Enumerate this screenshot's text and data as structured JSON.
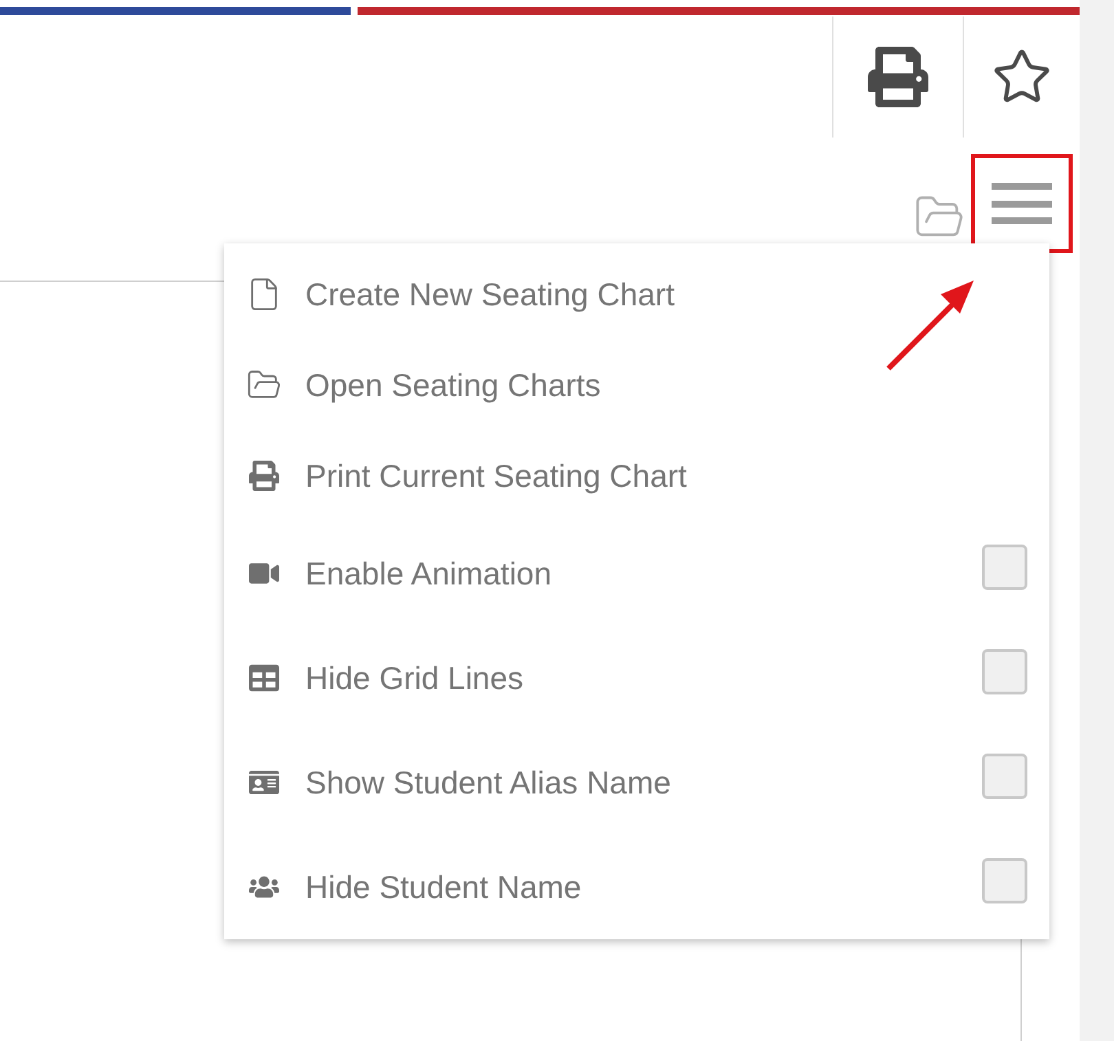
{
  "menu": {
    "items": [
      {
        "label": "Create New Seating Chart",
        "kind": "action"
      },
      {
        "label": "Open Seating Charts",
        "kind": "action"
      },
      {
        "label": "Print Current Seating Chart",
        "kind": "action"
      },
      {
        "label": "Enable Animation",
        "kind": "toggle",
        "checked": false
      },
      {
        "label": "Hide Grid Lines",
        "kind": "toggle",
        "checked": false
      },
      {
        "label": "Show Student Alias Name",
        "kind": "toggle",
        "checked": false
      },
      {
        "label": "Hide Student Name",
        "kind": "toggle",
        "checked": false
      }
    ]
  }
}
